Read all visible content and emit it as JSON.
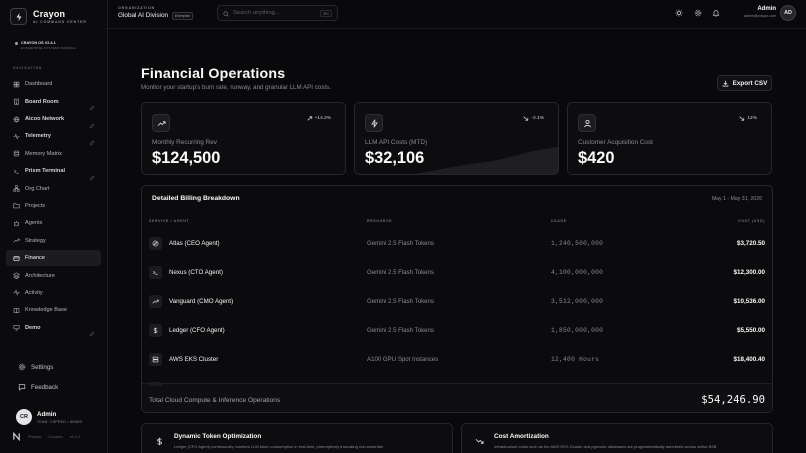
{
  "app": {
    "name": "Crayon",
    "subtitle": "AI COMMAND CENTER",
    "version": "CRAYON OS V2.4.1",
    "status": "ENTERPRISE SYSTEMS NOMINAL"
  },
  "sidebar": {
    "section_label": "NAVIGATION",
    "items": [
      {
        "label": "Dashboard",
        "icon": "grid-icon"
      },
      {
        "label": "Board Room",
        "icon": "building-icon",
        "bold": true,
        "pinned": true
      },
      {
        "label": "Aicoo Network",
        "icon": "globe-icon",
        "bold": true,
        "pinned": true
      },
      {
        "label": "Telemetry",
        "icon": "pulse-icon",
        "bold": true,
        "pinned": true
      },
      {
        "label": "Memory Matrix",
        "icon": "database-icon"
      },
      {
        "label": "Prism Terminal",
        "icon": "terminal-icon",
        "bold": true,
        "pinned": true
      },
      {
        "label": "Org Chart",
        "icon": "org-icon"
      },
      {
        "label": "Projects",
        "icon": "folder-icon"
      },
      {
        "label": "Agents",
        "icon": "bot-icon"
      },
      {
        "label": "Strategy",
        "icon": "trend-icon"
      },
      {
        "label": "Finance",
        "icon": "wallet-icon",
        "active": true
      },
      {
        "label": "Architecture",
        "icon": "layers-icon"
      },
      {
        "label": "Activity",
        "icon": "activity-icon"
      },
      {
        "label": "Knowledge Base",
        "icon": "book-icon"
      },
      {
        "label": "Demo",
        "icon": "monitor-icon",
        "bold": true,
        "pinned": true
      }
    ],
    "bottom": [
      {
        "label": "Settings",
        "icon": "gear-icon"
      },
      {
        "label": "Feedback",
        "icon": "message-icon"
      }
    ],
    "user": {
      "initials": "CR",
      "name": "Admin",
      "meta": "TEAM: CSPRED • ADMIN"
    },
    "footer_links": [
      "Privacy",
      "Cookies",
      "v0.4.1"
    ]
  },
  "topbar": {
    "org_label": "ORGANIZATION",
    "org_name": "Global AI Division",
    "org_badge": "Enterprise",
    "search_placeholder": "Search anything...",
    "search_shortcut": "⌘K",
    "admin_name": "Admin",
    "admin_email": "admin@crayon.com",
    "admin_initials": "AD"
  },
  "page": {
    "title": "Financial Operations",
    "subtitle": "Monitor your startup's burn rate, runway, and granular LLM API costs.",
    "export_label": "Export CSV"
  },
  "metrics": [
    {
      "label": "Monthly Recurring Rev",
      "value": "$124,500",
      "delta": "+14.2%",
      "trend": "up",
      "icon": "trend-up-icon",
      "spark": false
    },
    {
      "label": "LLM API Costs (MTD)",
      "value": "$32,106",
      "delta": "-2.1%",
      "trend": "down",
      "icon": "zap-icon",
      "spark": true
    },
    {
      "label": "Customer Acquisition Cost",
      "value": "$420",
      "delta": "12%",
      "trend": "down",
      "icon": "users-icon",
      "spark": false
    }
  ],
  "billing": {
    "title": "Detailed Billing Breakdown",
    "range": "May 1 - May 31, 2026",
    "columns": [
      "SERVICE / AGENT",
      "RESOURCE",
      "USAGE",
      "COST (USD)"
    ],
    "rows": [
      {
        "name": "Atlas (CEO Agent)",
        "icon": "compass-icon",
        "resource": "Gemini 2.5 Flash Tokens",
        "usage": "1,240,500,000",
        "cost": "$3,720.50"
      },
      {
        "name": "Nexus (CTO Agent)",
        "icon": "terminal-icon",
        "resource": "Gemini 2.5 Flash Tokens",
        "usage": "4,100,000,000",
        "cost": "$12,300.00"
      },
      {
        "name": "Vanguard (CMO Agent)",
        "icon": "trend-icon",
        "resource": "Gemini 2.5 Flash Tokens",
        "usage": "3,512,000,000",
        "cost": "$10,536.00"
      },
      {
        "name": "Ledger (CFO Agent)",
        "icon": "dollar-icon",
        "resource": "Gemini 2.5 Flash Tokens",
        "usage": "1,850,000,000",
        "cost": "$5,550.00"
      },
      {
        "name": "AWS EKS Cluster",
        "icon": "server-icon",
        "resource": "A100 GPU Spot Instances",
        "usage": "12,400 Hours",
        "cost": "$18,400.40"
      }
    ],
    "total_label": "Total Cloud Compute & Inference Operations",
    "total_value": "$54,246.90"
  },
  "insights": [
    {
      "title": "Dynamic Token Optimization",
      "icon": "dollar-icon",
      "text": "Ledger (CFO Agent) continuously monitors LLM token consumption in real-time, preemptively truncating non-essential"
    },
    {
      "title": "Cost Amortization",
      "icon": "trend-down-icon",
      "text": "Infrastructure costs such as the AWS EKS Cluster and pgvector databases are programmatically amortized across active B2B"
    }
  ]
}
